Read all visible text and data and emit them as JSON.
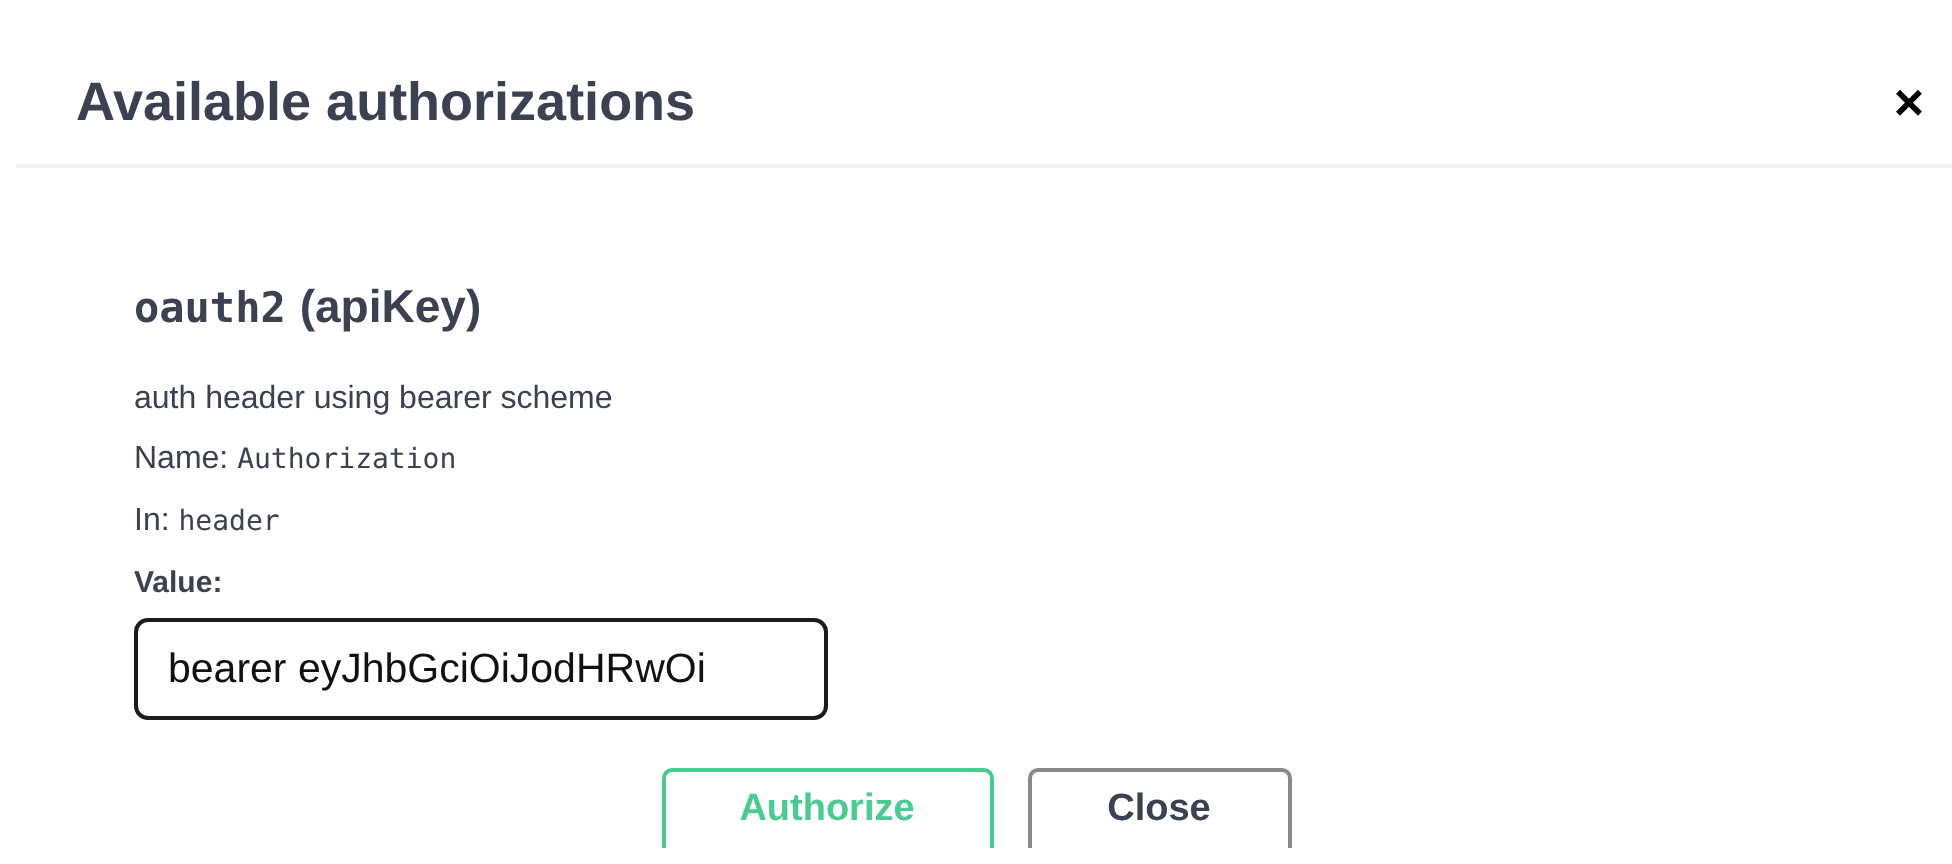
{
  "dialog": {
    "title": "Available authorizations",
    "close_icon": "×"
  },
  "scheme": {
    "name": "oauth2",
    "type": "(apiKey)",
    "description": "auth header using bearer scheme",
    "fields": [
      {
        "label": "Name:",
        "value": "Authorization"
      },
      {
        "label": "In:",
        "value": "header"
      }
    ],
    "value_label": "Value:",
    "value": "bearer eyJhbGciOiJodHRwOi"
  },
  "buttons": [
    {
      "label": "Authorize",
      "kind": "primary"
    },
    {
      "label": "Close",
      "kind": "secondary"
    }
  ]
}
